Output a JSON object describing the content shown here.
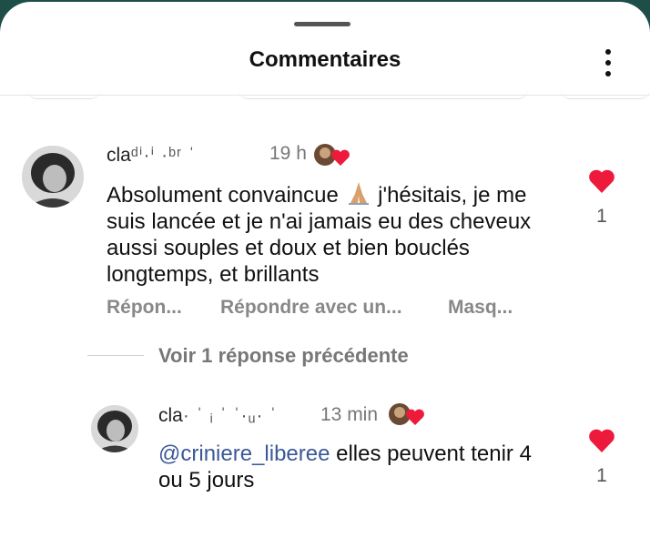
{
  "header": {
    "title": "Commentaires"
  },
  "comments": [
    {
      "username": "cla",
      "username_obscured": "ᵈⁱ·ⁱ  ·ᵇʳ ˈ",
      "time": "19 h",
      "text_before_emoji": "Absolument convaincue ",
      "text_after_emoji": " j'hésitais, je me suis lancée et je n'ai jamais eu des cheveux aussi souples et doux et bien bouclés longtemps, et brillants",
      "likes": "1",
      "actions": {
        "reply": "Répon...",
        "reply_with": "Répondre avec un...",
        "hide": "Masq..."
      }
    },
    {
      "username": "cla",
      "username_obscured": "·  ˈ ᵢ ˈ ˈ·ᵤ· ˈ",
      "time": "13 min",
      "mention": "@criniere_liberee",
      "text": " elles peuvent tenir 4 ou 5 jours",
      "likes": "1"
    }
  ],
  "replies_toggle": "Voir 1 réponse précédente",
  "icons": {
    "more": "kebab-menu-icon",
    "like": "heart-icon",
    "emoji": "praying-hands-icon",
    "creator_like": "creator-heart-badge-icon"
  },
  "colors": {
    "heart": "#ed1a3b",
    "mention": "#3b5998",
    "backdrop": "#1d4f48"
  }
}
